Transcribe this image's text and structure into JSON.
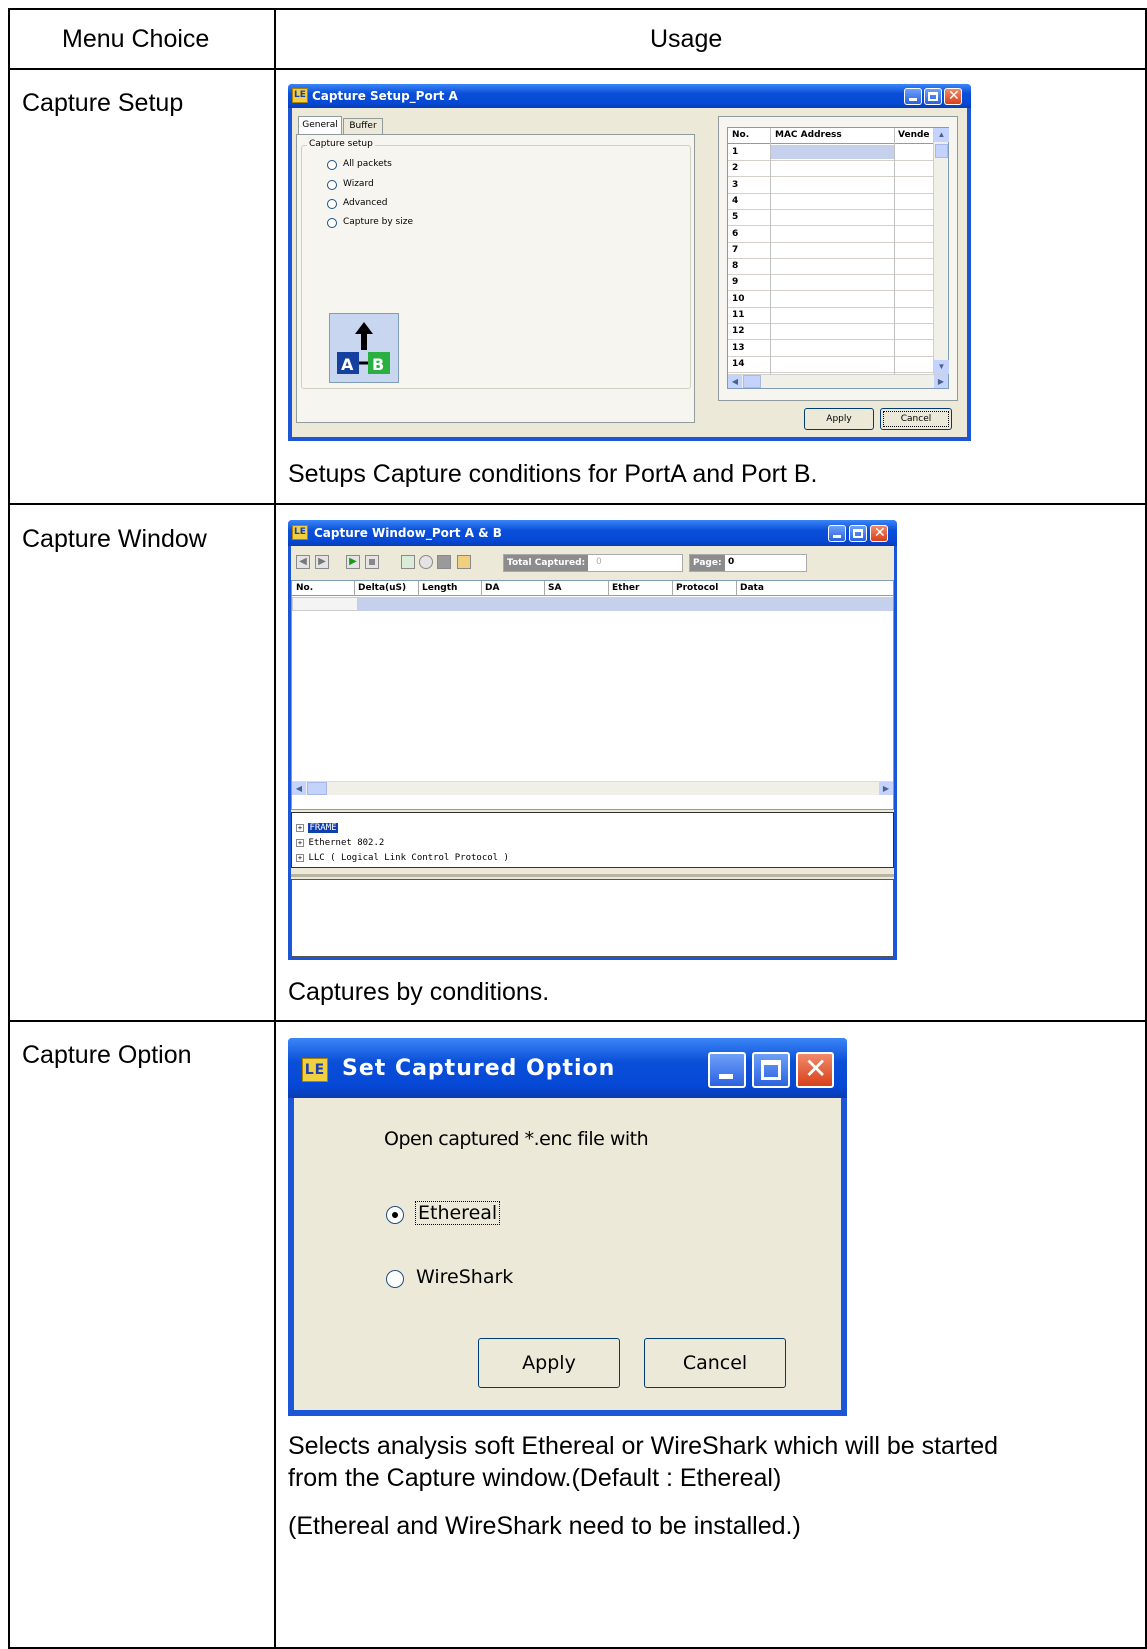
{
  "header": {
    "col1": "Menu Choice",
    "col2": "Usage"
  },
  "rows": [
    {
      "menu": "Capture Setup",
      "desc": "Setups Capture conditions for PortA and Port B.",
      "window": {
        "title": "Capture Setup_Port A",
        "tabs": [
          "General",
          "Buffer"
        ],
        "group_label": "Capture setup",
        "options": [
          "All packets",
          "Wizard",
          "Advanced",
          "Capture by size"
        ],
        "selected": "All packets",
        "icon_label": "A→B",
        "grid_headers": [
          "No.",
          "MAC Address",
          "Vende"
        ],
        "grid_rows": [
          "1",
          "2",
          "3",
          "4",
          "5",
          "6",
          "7",
          "8",
          "9",
          "10",
          "11",
          "12",
          "13",
          "14"
        ],
        "apply": "Apply",
        "cancel": "Cancel"
      }
    },
    {
      "menu": "Capture Window",
      "desc": "Captures by conditions.",
      "window": {
        "title": "Capture Window_Port A & B",
        "total_captured_label": "Total Captured:",
        "total_captured_value": "0",
        "page_label": "Page:",
        "page_value": "0",
        "columns": [
          "No.",
          "Delta(uS)",
          "Length",
          "DA",
          "SA",
          "Ether",
          "Protocol",
          "Data"
        ],
        "tree": [
          "FRAME",
          "Ethernet 802.2",
          "LLC ( Logical Link Control Protocol )"
        ]
      }
    },
    {
      "menu": "Capture Option",
      "desc1": "Selects analysis soft Ethereal or WireShark which will be started",
      "desc2": "from the Capture window.(Default : Ethereal)",
      "desc3": "(Ethereal and WireShark need to be installed.)",
      "window": {
        "title": "Set Captured Option",
        "prompt": "Open captured  *.enc file with",
        "options": [
          "Ethereal",
          "WireShark"
        ],
        "selected": "Ethereal",
        "apply": "Apply",
        "cancel": "Cancel"
      }
    }
  ],
  "icon": "LE"
}
